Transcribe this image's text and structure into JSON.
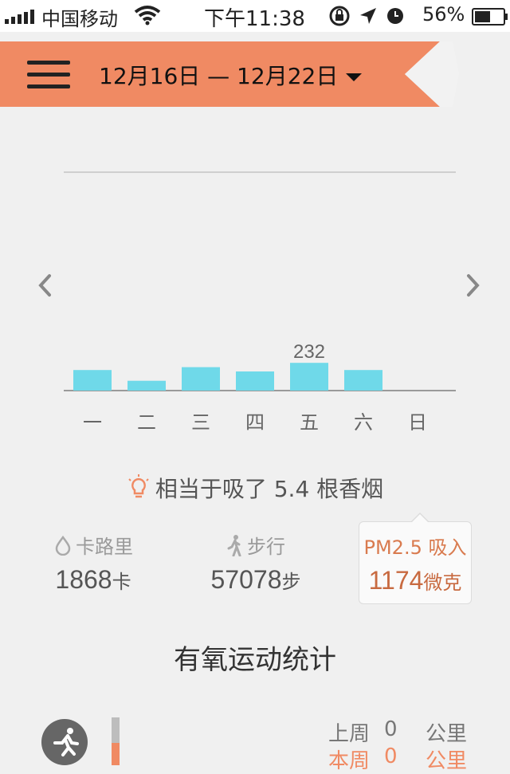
{
  "status_bar": {
    "carrier": "中国移动",
    "time": "下午11:38",
    "battery": "56%",
    "battery_level": 0.56
  },
  "header": {
    "date_range": "12月16日 — 12月22日",
    "accent_color": "#f08a63"
  },
  "chart_data": {
    "type": "bar",
    "categories": [
      "一",
      "二",
      "三",
      "四",
      "五",
      "六",
      "日"
    ],
    "values": [
      222,
      207,
      226,
      220,
      232,
      222,
      null
    ],
    "highlight_label": "232",
    "bar_color": "#6fd9e9"
  },
  "tip": {
    "text": "相当于吸了 5.4 根香烟"
  },
  "stats": {
    "calories": {
      "label": "卡路里",
      "value": "1868",
      "unit": "卡"
    },
    "steps": {
      "label": "步行",
      "value": "57078",
      "unit": "步"
    },
    "pm25": {
      "label": "PM2.5 吸入",
      "value": "1174",
      "unit": "微克"
    }
  },
  "aerobic": {
    "title": "有氧运动统计",
    "last_week": {
      "label": "上周",
      "value": "0",
      "unit": "公里"
    },
    "this_week": {
      "label": "本周",
      "value": "0",
      "unit": "公里"
    }
  }
}
